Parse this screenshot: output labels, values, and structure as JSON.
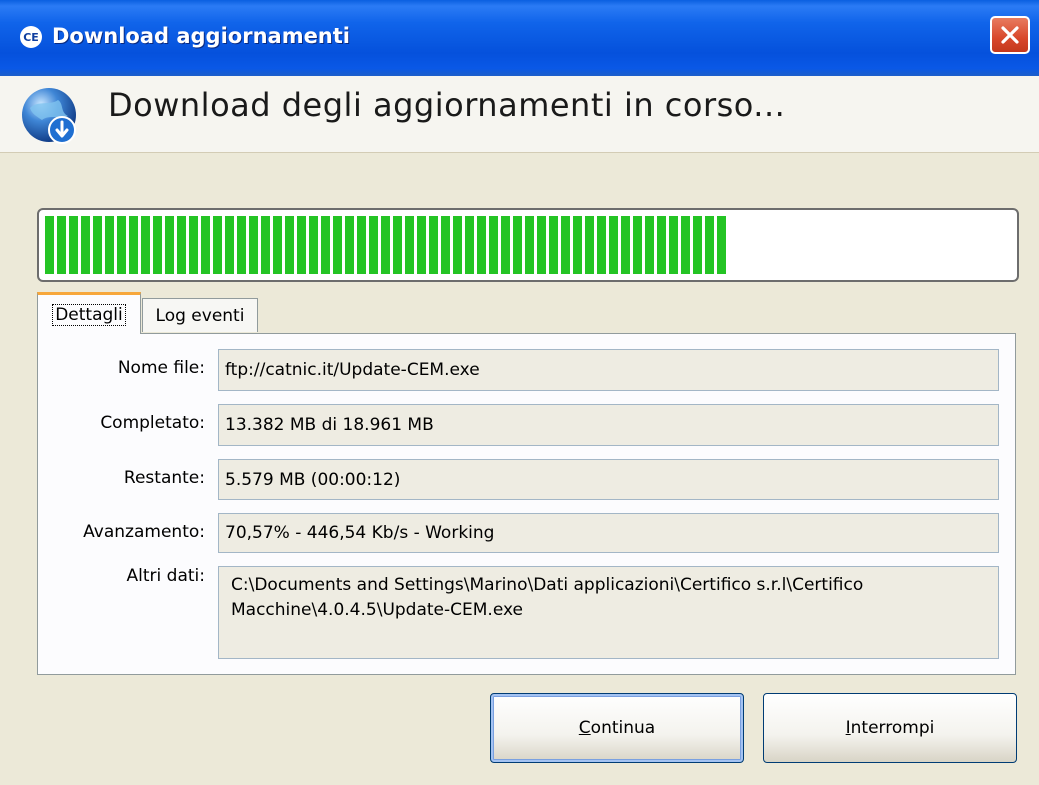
{
  "window": {
    "title": "Download aggiornamenti",
    "app_icon_text": "CE"
  },
  "header": {
    "title": "Download degli aggiornamenti in corso..."
  },
  "progress": {
    "value_percent": 70.57,
    "fill_color": "#24c424"
  },
  "tabs": [
    {
      "label": "Dettagli",
      "active": true
    },
    {
      "label": "Log eventi",
      "active": false
    }
  ],
  "details": {
    "nome_file_label": "Nome file:",
    "nome_file_value": "ftp://catnic.it/Update-CEM.exe",
    "completato_label": "Completato:",
    "completato_value": "13.382 MB di 18.961 MB",
    "restante_label": "Restante:",
    "restante_value": "5.579 MB (00:00:12)",
    "avanzamento_label": "Avanzamento:",
    "avanzamento_value": "70,57% - 446,54 Kb/s - Working",
    "altri_dati_label": "Altri dati:",
    "altri_dati_value": "C:\\Documents and Settings\\Marino\\Dati applicazioni\\Certifico s.r.l\\Certifico Macchine\\4.0.4.5\\Update-CEM.exe"
  },
  "buttons": {
    "continua_first": "C",
    "continua_rest": "ontinua",
    "interrompi_first": "I",
    "interrompi_rest": "nterrompi"
  },
  "icons": {
    "app": "ce-app-icon",
    "close": "close-icon",
    "header": "globe-download-icon"
  },
  "colors": {
    "titlebar": "#0551dc",
    "close": "#d8472a",
    "progress": "#24c424",
    "window_bg": "#ece9d8"
  }
}
